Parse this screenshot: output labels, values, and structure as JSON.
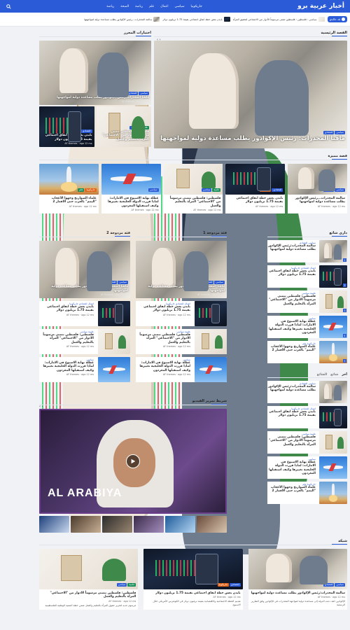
{
  "header": {
    "logo": "أخبار عربية برو",
    "nav": [
      "جاريكوبيا",
      "سياسي",
      "اعمال",
      "علم",
      "رياضة",
      "الصحة",
      "رياضة"
    ],
    "search_icon": "search-icon"
  },
  "ticker": {
    "live_label": "قد خالدي",
    "items": [
      "سياسي : فلسطين : فلسطين تتمنى مرسوماً الأدوار من الاجتماعي لتحقيق المرأة",
      "بايدن بعش خطة انفاق اجتماعي بقيمة 1.75 تريليون دولار",
      "سالمة المحذرات...رئيس الإكوادور يطلب مساعدة دولية لمواجهتها"
    ]
  },
  "main_story": {
    "section": "القصة الرئيسية",
    "tags": [
      "سياسي",
      "اقتصادي"
    ],
    "title": "مافيا المخدرات: رئيس الإكوادور يطلب مساعدة دولية لمواجهتها",
    "author": "AF themes",
    "date": "ago 2 ms"
  },
  "editor_picks": {
    "section": "اختيارات المحرر",
    "top": {
      "tags": [
        "سياسي",
        "اقتصادي"
      ],
      "title": "مافيا المخدرات:رئيس الإكوادور يطلب مساعدة دولية لمواجهتها",
      "author": "AF themes",
      "date": "ago 10 ms"
    },
    "bottom": [
      {
        "tags": [
          "علمية",
          "سياسي"
        ],
        "title": "فلسطين: فلسطين تتمنى مرسوماً الأدوار من \"الاجتماعي\" المرأة بالتعليم والعمل",
        "author": "AF themes",
        "date": "ago 12 ms"
      },
      {
        "tags": [
          "اقتصادي",
          "جاريكوبيا"
        ],
        "title": "بايدن يعش خطة انفاق اجتماعي بقيمة 1.75 تريليون دولار",
        "author": "AF themes",
        "date": "ago 12 ms"
      }
    ]
  },
  "featured": {
    "section": "قصة مميزة",
    "cards": [
      {
        "img": "meeting",
        "tags": [
          "سياسي",
          "اقتصادي"
        ],
        "title": "سالمة المحذرات...رئيس الإكوادور يطلب مساعدة دولية لمواجهتها",
        "author": "AF themes",
        "date": "ago 12 ms"
      },
      {
        "img": "chart",
        "tags": [
          "اقتصادي",
          "جاريكوبيا"
        ],
        "title": "بايدن يعش خطة انفاق اجتماعي بقيمة 1.75 تريليون دولار",
        "author": "AF themes",
        "date": "ago 12 ms"
      },
      {
        "img": "plant",
        "tags": [
          "علمية",
          "سياسي"
        ],
        "title": "فلسطين: فلسطين تتمنى مرسوماً من \"الاجتماعي\" المرأة بالتعليم والعمل",
        "author": "AF themes",
        "date": "ago 12 ms"
      },
      {
        "img": "plane",
        "tags": [
          "سياسي"
        ],
        "title": "عطلة نهاية الاسبوع في الامارات: لماذا قررت الدولة الخليجية تغييرها وكيف استقبلها المغردون",
        "author": "AF themes",
        "date": "ago 12 ms"
      },
      {
        "img": "rocket",
        "tags": [
          "جاريكوبيا",
          "علم"
        ],
        "title": "علماء الصواريخ وجهوا الأعجاب \"اليمم\" بالعرب حتى الأقمار 2",
        "author": "AF themes",
        "date": "ago 12 ms"
      }
    ]
  },
  "mixed1": {
    "section": "فئة مزدوجة 1",
    "big": {
      "tags": [
        "سياسي",
        "اقتصادي"
      ],
      "title": "مافيا المخدرات:رئيس الإكوادور يطلب مساعدة دولية لمواجهتها",
      "author": "AF themes",
      "date": "ago 12 ms"
    },
    "list": [
      {
        "img": "chart",
        "tag": "اعمال اقتصادي جاريكوبيا",
        "title": "بايدن يعش خطة انفاق اجتماعي بقيمة 1.75 تريليون دولار",
        "author": "AF themes",
        "date": "ago 12 ms"
      },
      {
        "img": "plant",
        "tag": "علمية سياسي",
        "title": "فلسطين: فلسطين تتمنى مرسوماً الأدوار من \"الاجتماعي\" المرأة بالتعليم والعمل",
        "author": "AF themes",
        "date": "ago 12 ms"
      },
      {
        "img": "plane",
        "tag": "سياسي",
        "title": "عطلة نهاية الاسبوع في الامارات: لماذا قررت الدولة الخليجية تغييرها وكيف استقبلها المغردون",
        "author": "AF themes",
        "date": "ago 12 ms"
      }
    ]
  },
  "mixed2": {
    "section": "فئة مزدوجة 2",
    "big": {
      "tags": [
        "سياسي",
        "اقتصادي"
      ],
      "title": "مافيا المخدرات:رئيس الإكوادور يطلب مساعدة دولية لمواجهتها",
      "author": "AF themes",
      "date": "ago 12 ms"
    },
    "list": [
      {
        "img": "chart",
        "tag": "اعمال اقتصادي جاريكوبيا",
        "title": "بايدن يعش خطة انفاق اجتماعي بقيمة 1.75 تريليون دولار",
        "author": "AF themes",
        "date": "ago 12 ms"
      },
      {
        "img": "plant",
        "tag": "علمية سياسي",
        "title": "فلسطين: فلسطين تتمنى مرسوماً الأدوار من \"الاجتماعي\" المرأة بالتعليم والعمل",
        "author": "AF themes",
        "date": "ago 12 ms"
      },
      {
        "img": "plane",
        "tag": "سياسي",
        "title": "عطلة نهاية الاسبوع في الامارات: لماذا قررت الدولة الخليجية تغييرها وكيف استقبلها المغردون",
        "author": "AF themes",
        "date": "ago 12 ms"
      }
    ]
  },
  "trending": {
    "section": "داري شائع",
    "items": [
      {
        "img": "meeting",
        "num": "1",
        "tag": "سياسي اقتصادي",
        "title": "سالمة المحذرات:رئيس الإكوادور يطلب مساعدة دولية لمواجهتها"
      },
      {
        "img": "chart",
        "num": "2",
        "tag": "اعمال اقتصادي جاريكوبيا",
        "title": "بايدن يعش خطة انفاق اجتماعي بقيمة 1.75 تريليون دولار"
      },
      {
        "img": "plant",
        "num": "3",
        "tag": "علمية سياسي",
        "title": "فلسطين: فلسطين تتمنى مرسوماً الأدوار من \"الاجتماعي\" المرأة بالتعليم والعمل"
      },
      {
        "img": "plane",
        "num": "4",
        "tag": "سياسي",
        "title": "عطلة نهاية الاسبوع في الامارات: لماذا قررت الدولة الخليجية تغييرها وكيف استقبلها المغردون"
      },
      {
        "img": "rocket",
        "num": "5",
        "tag": "جاريكوبيا علم",
        "title": "علماء الصواريخ وجهوا الأعجاب \"اليمم\" بالعرب حتى الأقمار 2"
      }
    ]
  },
  "latest": {
    "tabs": [
      "آخر",
      "شائع",
      "الشائع"
    ],
    "items": [
      {
        "img": "meeting",
        "tag": "سياسي اقتصادي",
        "title": "سالمة المحذرات:رئيس الإكوادور يطلب مساعدة دولية لمواجهتها"
      },
      {
        "img": "chart",
        "tag": "اعمال اقتصادي جاريكوبيا",
        "title": "بايدن يعش خطة انفاق اجتماعي بقيمة 1.75 تريليون دولار"
      },
      {
        "img": "plant",
        "tag": "علمية سياسي",
        "title": "فلسطين: فلسطين تتمنى مرسوماً الأدوار من \"الاجتماعي\" المرأة بالتعليم والعمل"
      },
      {
        "img": "plane",
        "tag": "سياسي",
        "title": "عطلة نهاية الاسبوع في الامارات: لماذا قررت الدولة الخليجية تغييرها وكيف استقبلها المغردون"
      },
      {
        "img": "rocket",
        "tag": "جاريكوبيا علم",
        "title": "علماء الصواريخ وجهوا الأعجاب \"اليمم\" بالعرب حتى الأقمار 2"
      }
    ]
  },
  "video": {
    "section": "شريط تمرير الفيديو",
    "watermark": "AL ARABIYA"
  },
  "grid": {
    "section": "شبكة",
    "cards": [
      {
        "img": "meeting",
        "tags": [
          "سياسي",
          "اقتصادي"
        ],
        "title": "سالمة المحذرات:رئيس الإكوادور يطلب مساعدة دولية لمواجهتها",
        "author": "AF themes",
        "date": "ago 12 ms",
        "excerpt": "الإكوادور: لقد دعت الدولة إلى مساعدة دولية لمواجهة المخدرات في الإكوادور وفق التقارير الرسمية"
      },
      {
        "img": "chart",
        "tags": [
          "اقتصادي",
          "جاريكوبيا"
        ],
        "title": "بايدن يعش خطة انفاق اجتماعي بقيمة 1.75 تريليون دولار",
        "author": "AF themes",
        "date": "ago 12 ms",
        "excerpt": "تقديم الخطة الاجتماعية والاقتصادية بقيمة تريليون دولار في الكونغرس الأمريكي خلال الاسبوع"
      },
      {
        "img": "plant",
        "tags": [
          "علمية",
          "سياسي"
        ],
        "title": "فلسطين: فلسطين تتمنى مرسوماً الأدوار من \"الاجتماعي\" المرأة بالتعليم والعمل",
        "author": "AF themes",
        "date": "ago 12 ms",
        "excerpt": "مرسوم جديد لتعزيز حقوق المرأة بالتعليم والعمل ضمن خطة التنمية الوطنية الفلسطينية"
      }
    ]
  }
}
